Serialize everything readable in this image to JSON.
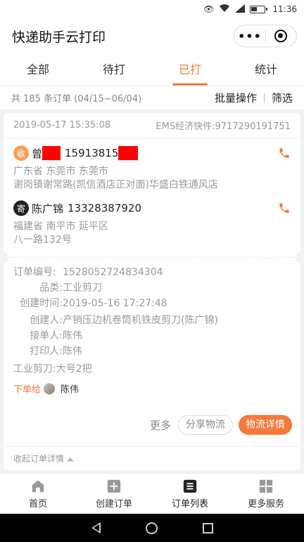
{
  "status_bar": {
    "time": "11:36"
  },
  "header": {
    "title": "快递助手云打印",
    "more_label": "•••"
  },
  "tabs": [
    {
      "label": "全部"
    },
    {
      "label": "待打"
    },
    {
      "label": "已打",
      "active": true
    },
    {
      "label": "统计"
    }
  ],
  "summary": {
    "count_text": "共 185 条订单 (04/15~06/04)",
    "batch_label": "批量操作",
    "filter_label": "筛选"
  },
  "order": {
    "time": "2019-05-17 15:35:08",
    "carrier": "EMS经济快件:9717290191751",
    "receiver": {
      "tag": "收",
      "name_prefix": "曾",
      "phone_prefix": "15913815",
      "region": "广东省 东莞市 东莞市",
      "address": "谢岗镇谢常路(凯信酒店正对面)华盛白铁通风店"
    },
    "sender": {
      "tag": "寄",
      "name": "陈广锦",
      "phone": "13328387920",
      "region": "福建省 南平市 延平区",
      "address": "八一路132号"
    },
    "details": {
      "order_no_label": "订单编号:",
      "order_no": "1528052724834304",
      "category_label": "品类:",
      "category": "工业剪刀",
      "created_label": "创建时间:",
      "created": "2019-05-16 17:27:48",
      "creator_label": "创建人:",
      "creator": "产销压边机卷筒机铁皮剪刀(陈广锦)",
      "receiver_label": "接单人:",
      "receiver_name": "陈伟",
      "printer_label": "打印人:",
      "printer": "陈伟",
      "note": "工业剪刀:大号2把",
      "placed_label": "下单给",
      "placed_name": "陈伟"
    },
    "actions": {
      "more": "更多",
      "share": "分享物流",
      "logistics": "物流详情"
    },
    "collapse_label": "收起订单详情"
  },
  "tabbar": [
    {
      "label": "首页",
      "icon": "home-icon"
    },
    {
      "label": "创建订单",
      "icon": "plus-icon"
    },
    {
      "label": "订单列表",
      "icon": "list-icon",
      "active": true
    },
    {
      "label": "更多服务",
      "icon": "grid-icon"
    }
  ],
  "colors": {
    "accent": "#f5793a",
    "redaction": "#ff0000"
  }
}
